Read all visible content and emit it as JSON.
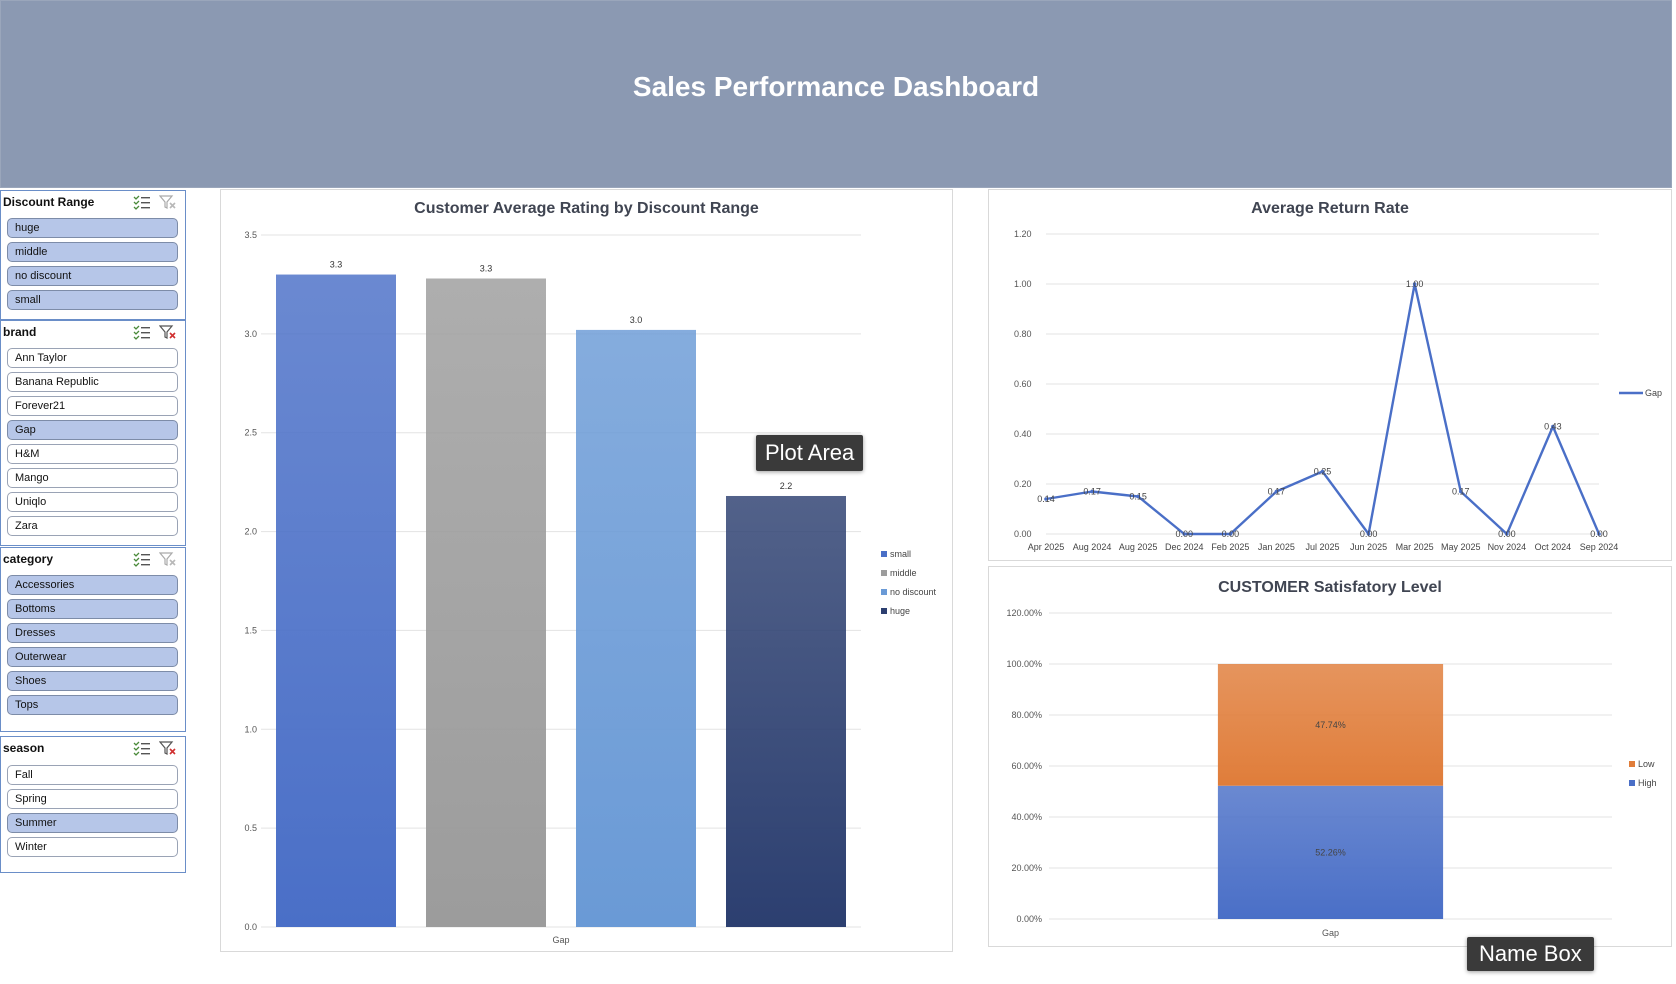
{
  "header": {
    "title": "Sales Performance Dashboard"
  },
  "slicers": [
    {
      "title": "Discount Range",
      "filtered": false,
      "items": [
        {
          "label": "huge",
          "selected": true
        },
        {
          "label": "middle",
          "selected": true
        },
        {
          "label": "no discount",
          "selected": true
        },
        {
          "label": "small",
          "selected": true
        }
      ]
    },
    {
      "title": "brand",
      "filtered": true,
      "items": [
        {
          "label": "Ann  Taylor",
          "selected": false
        },
        {
          "label": "Banana  Republic",
          "selected": false
        },
        {
          "label": "Forever21",
          "selected": false
        },
        {
          "label": "Gap",
          "selected": true
        },
        {
          "label": "H&M",
          "selected": false
        },
        {
          "label": "Mango",
          "selected": false
        },
        {
          "label": "Uniqlo",
          "selected": false
        },
        {
          "label": "Zara",
          "selected": false
        }
      ]
    },
    {
      "title": "category",
      "filtered": false,
      "items": [
        {
          "label": "Accessories",
          "selected": true
        },
        {
          "label": "Bottoms",
          "selected": true
        },
        {
          "label": "Dresses",
          "selected": true
        },
        {
          "label": "Outerwear",
          "selected": true
        },
        {
          "label": "Shoes",
          "selected": true
        },
        {
          "label": "Tops",
          "selected": true
        }
      ]
    },
    {
      "title": "season",
      "filtered": true,
      "items": [
        {
          "label": "Fall",
          "selected": false
        },
        {
          "label": "Spring",
          "selected": false
        },
        {
          "label": "Summer",
          "selected": true
        },
        {
          "label": "Winter",
          "selected": false
        }
      ]
    }
  ],
  "tooltips": {
    "plot_area": "Plot Area",
    "name_box": "Name Box"
  },
  "chart_data": [
    {
      "id": "rating",
      "type": "bar",
      "title": "Customer Average Rating by Discount Range",
      "categories": [
        "Gap"
      ],
      "series": [
        {
          "name": "small",
          "values": [
            3.3
          ],
          "label": "3.3",
          "color": "#4a6fc7"
        },
        {
          "name": "middle",
          "values": [
            3.28
          ],
          "label": "3.3",
          "color": "#9c9c9c"
        },
        {
          "name": "no discount",
          "values": [
            3.02
          ],
          "label": "3.0",
          "color": "#6a9ad6"
        },
        {
          "name": "huge",
          "values": [
            2.18
          ],
          "label": "2.2",
          "color": "#2c3f70"
        }
      ],
      "yticks": [
        "0.0",
        "0.5",
        "1.0",
        "1.5",
        "2.0",
        "2.5",
        "3.0",
        "3.5"
      ],
      "ylim": [
        0,
        3.5
      ],
      "grid": true,
      "legend": "right"
    },
    {
      "id": "return",
      "type": "line",
      "title": "Average Return Rate",
      "x": [
        "Apr 2025",
        "Aug 2024",
        "Aug 2025",
        "Dec 2024",
        "Feb 2025",
        "Jan 2025",
        "Jul 2025",
        "Jun 2025",
        "Mar 2025",
        "May 2025",
        "Nov 2024",
        "Oct 2024",
        "Sep 2024"
      ],
      "series": [
        {
          "name": "Gap",
          "values": [
            0.14,
            0.17,
            0.15,
            0.0,
            0.0,
            0.17,
            0.25,
            0.0,
            1.0,
            0.17,
            0.0,
            0.43,
            0.0
          ],
          "labels": [
            "0.14",
            "0.17",
            "0.15",
            "0.00",
            "0.00",
            "0.17",
            "0.25",
            "0.00",
            "1.00",
            "0.17",
            "0.00",
            "0.43",
            "0.00"
          ],
          "color": "#4a6fc7"
        }
      ],
      "yticks": [
        "0.00",
        "0.20",
        "0.40",
        "0.60",
        "0.80",
        "1.00",
        "1.20"
      ],
      "ylim": [
        0,
        1.2
      ],
      "grid": true,
      "legend": "right"
    },
    {
      "id": "satisfaction",
      "type": "bar",
      "stacked": true,
      "title": "CUSTOMER Satisfatory Level",
      "categories": [
        "Gap"
      ],
      "series": [
        {
          "name": "High",
          "values": [
            52.26
          ],
          "label": "52.26%",
          "color": "#4a6fc7"
        },
        {
          "name": "Low",
          "values": [
            47.74
          ],
          "label": "47.74%",
          "color": "#e07d3a"
        }
      ],
      "yticks": [
        "0.00%",
        "20.00%",
        "40.00%",
        "60.00%",
        "80.00%",
        "100.00%",
        "120.00%"
      ],
      "ylim": [
        0,
        120
      ],
      "grid": true,
      "legend": "right"
    }
  ]
}
